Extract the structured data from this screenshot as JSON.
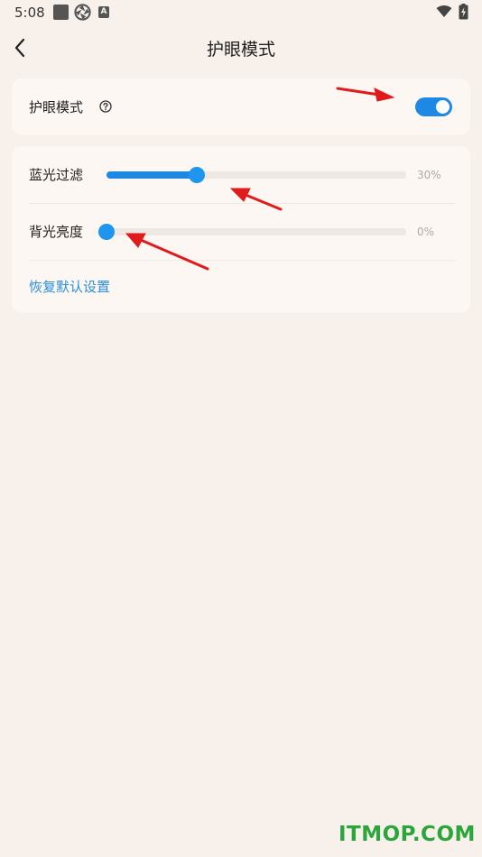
{
  "status_bar": {
    "time": "5:08",
    "icons": [
      "square-icon",
      "aperture-icon",
      "a-icon",
      "wifi-icon",
      "battery-icon"
    ]
  },
  "header": {
    "title": "护眼模式",
    "back_icon": "chevron-left-icon"
  },
  "eye_mode": {
    "label": "护眼模式",
    "help_icon": "question-circle-icon",
    "enabled": true
  },
  "sliders": [
    {
      "label": "蓝光过滤",
      "value_text": "30%",
      "value": 0.3
    },
    {
      "label": "背光亮度",
      "value_text": "0%",
      "value": 0.0
    }
  ],
  "reset_label": "恢复默认设置",
  "watermark": "ITMOP.COM",
  "colors": {
    "background": "#f8f0ea",
    "card": "#fdf7f3",
    "accent": "#1e88e5",
    "link": "#2a8fd8",
    "annotation_arrow": "#e01b1b",
    "watermark": "#2aa63a"
  }
}
